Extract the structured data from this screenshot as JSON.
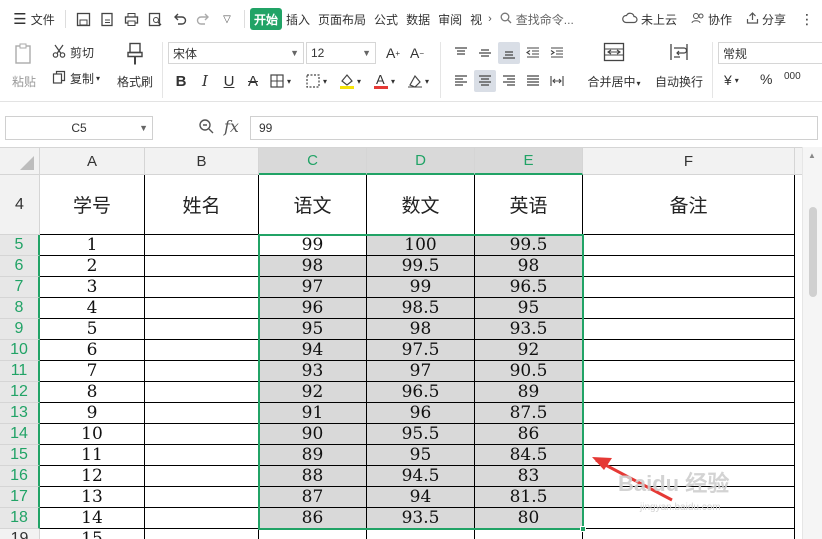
{
  "menubar": {
    "file_label": "文件",
    "tabs": [
      "开始",
      "插入",
      "页面布局",
      "公式",
      "数据",
      "审阅",
      "视"
    ],
    "active_tab": "开始",
    "search_placeholder": "查找命令...",
    "cloud_label": "未上云",
    "collab_label": "协作",
    "share_label": "分享"
  },
  "ribbon": {
    "paste_label": "粘贴",
    "cut_label": "剪切",
    "copy_label": "复制",
    "format_painter_label": "格式刷",
    "font_name": "宋体",
    "font_size": "12",
    "merge_label": "合并居中",
    "wrap_label": "自动换行",
    "number_format": "常规",
    "currency_symbol": "¥",
    "percent_symbol": "%",
    "thousands_symbol": "000"
  },
  "formula_bar": {
    "cell_ref": "C5",
    "fx_label": "fx",
    "value": "99"
  },
  "columns": [
    "A",
    "B",
    "C",
    "D",
    "E",
    "F"
  ],
  "selected_columns": [
    "C",
    "D",
    "E"
  ],
  "header_row": {
    "row_number": "4",
    "cells": [
      "学号",
      "姓名",
      "语文",
      "数文",
      "英语",
      "备注"
    ]
  },
  "rows": [
    {
      "n": "5",
      "id": "1",
      "yw": "99",
      "sx": "100",
      "yy": "99.5"
    },
    {
      "n": "6",
      "id": "2",
      "yw": "98",
      "sx": "99.5",
      "yy": "98"
    },
    {
      "n": "7",
      "id": "3",
      "yw": "97",
      "sx": "99",
      "yy": "96.5"
    },
    {
      "n": "8",
      "id": "4",
      "yw": "96",
      "sx": "98.5",
      "yy": "95"
    },
    {
      "n": "9",
      "id": "5",
      "yw": "95",
      "sx": "98",
      "yy": "93.5"
    },
    {
      "n": "10",
      "id": "6",
      "yw": "94",
      "sx": "97.5",
      "yy": "92"
    },
    {
      "n": "11",
      "id": "7",
      "yw": "93",
      "sx": "97",
      "yy": "90.5"
    },
    {
      "n": "12",
      "id": "8",
      "yw": "92",
      "sx": "96.5",
      "yy": "89"
    },
    {
      "n": "13",
      "id": "9",
      "yw": "91",
      "sx": "96",
      "yy": "87.5"
    },
    {
      "n": "14",
      "id": "10",
      "yw": "90",
      "sx": "95.5",
      "yy": "86"
    },
    {
      "n": "15",
      "id": "11",
      "yw": "89",
      "sx": "95",
      "yy": "84.5"
    },
    {
      "n": "16",
      "id": "12",
      "yw": "88",
      "sx": "94.5",
      "yy": "83"
    },
    {
      "n": "17",
      "id": "13",
      "yw": "87",
      "sx": "94",
      "yy": "81.5"
    },
    {
      "n": "18",
      "id": "14",
      "yw": "86",
      "sx": "93.5",
      "yy": "80"
    },
    {
      "n": "19",
      "id": "15",
      "yw": "",
      "sx": "",
      "yy": ""
    }
  ],
  "watermark": {
    "text": "Baidu 经验",
    "sub": "jingyan.baidu.com"
  },
  "colors": {
    "accent_green": "#21a366",
    "selection_fill": "#d9d9d9",
    "arrow_red": "#e53935"
  }
}
